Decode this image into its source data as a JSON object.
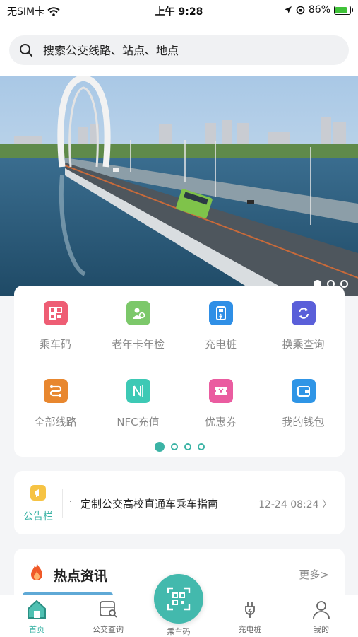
{
  "status_bar": {
    "carrier": "无SIM卡",
    "time": "上午 9:28",
    "battery_percent": "86%",
    "battery_level": 0.86
  },
  "search": {
    "placeholder": "搜索公交线路、站点、地点"
  },
  "banner": {
    "page_count": 3,
    "active_page": 1
  },
  "grid": {
    "items": [
      {
        "label": "乘车码",
        "icon": "bus-qr-icon",
        "color": "#ee5d74"
      },
      {
        "label": "老年卡年检",
        "icon": "senior-card-icon",
        "color": "#7cc86a"
      },
      {
        "label": "充电桩",
        "icon": "charging-pile-icon",
        "color": "#2f8fe6"
      },
      {
        "label": "换乘查询",
        "icon": "transfer-icon",
        "color": "#5a5fd9"
      },
      {
        "label": "全部线路",
        "icon": "all-routes-icon",
        "color": "#e8872f"
      },
      {
        "label": "NFC充值",
        "icon": "nfc-icon",
        "color": "#3dc9b5"
      },
      {
        "label": "优惠券",
        "icon": "coupon-icon",
        "color": "#ea5ca0"
      },
      {
        "label": "我的钱包",
        "icon": "wallet-icon",
        "color": "#2f95e6"
      }
    ],
    "pager": {
      "page_count": 4,
      "active_page": 1
    }
  },
  "notice": {
    "label": "公告栏",
    "bullet": "·",
    "text": "定制公交高校直通车乘车指南",
    "date": "12-24 08:24"
  },
  "hot": {
    "title": "热点资讯",
    "more": "更多>"
  },
  "tabbar": {
    "items": [
      {
        "label": "首页",
        "icon": "home-icon",
        "active": true
      },
      {
        "label": "公交查询",
        "icon": "bus-search-icon",
        "active": false
      },
      {
        "label": "乘车码",
        "icon": "qr-scan-icon",
        "active": false
      },
      {
        "label": "充电桩",
        "icon": "plug-icon",
        "active": false
      },
      {
        "label": "我的",
        "icon": "user-icon",
        "active": false
      }
    ]
  },
  "colors": {
    "accent": "#3bb3a5"
  }
}
